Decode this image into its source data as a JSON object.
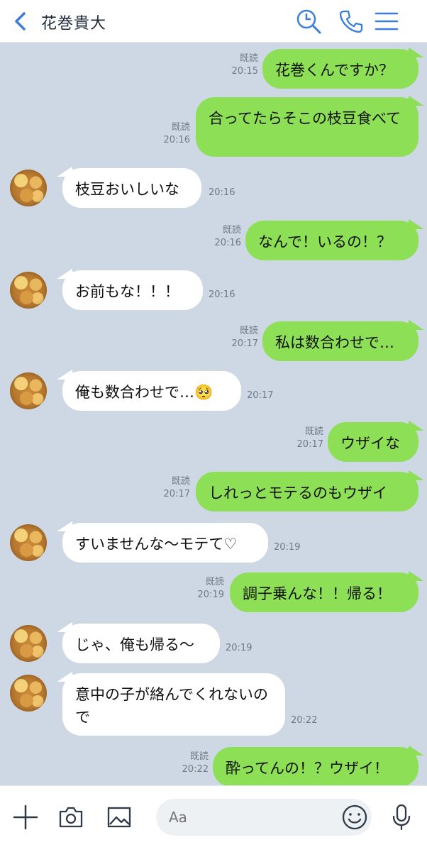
{
  "header": {
    "title": "花巻貴大"
  },
  "icons": {
    "back": "chevron-left-icon",
    "search": "search-icon",
    "call": "phone-icon",
    "menu": "hamburger-menu-icon"
  },
  "colors": {
    "outgoing": "#8de055",
    "incoming": "#ffffff",
    "chat_bg": "#ced7e4",
    "accent": "#3b7ddd"
  },
  "messages": [
    {
      "from": "me",
      "text": "花巻くんですか？",
      "read": "既読",
      "time": "20:15"
    },
    {
      "from": "me",
      "text": "合ってたらそこの枝豆食べて",
      "read": "既読",
      "time": "20:16"
    },
    {
      "from": "them",
      "text": "枝豆おいしいな",
      "time": "20:16"
    },
    {
      "from": "me",
      "text": "なんで！いるの！？",
      "read": "既読",
      "time": "20:16"
    },
    {
      "from": "them",
      "text": "お前もな！！！",
      "time": "20:16"
    },
    {
      "from": "me",
      "text": "私は数合わせで…",
      "read": "既読",
      "time": "20:17"
    },
    {
      "from": "them",
      "text": "俺も数合わせで…🥺",
      "time": "20:17"
    },
    {
      "from": "me",
      "text": "ウザイな",
      "read": "既読",
      "time": "20:17"
    },
    {
      "from": "me",
      "text": "しれっとモテるのもウザイ",
      "read": "既読",
      "time": "20:17"
    },
    {
      "from": "them",
      "text": "すいませんな〜モテて♡",
      "time": "20:19"
    },
    {
      "from": "me",
      "text": "調子乗んな！！帰る！",
      "read": "既読",
      "time": "20:19"
    },
    {
      "from": "them",
      "text": "じゃ、俺も帰る〜",
      "time": "20:19"
    },
    {
      "from": "them",
      "text": "意中の子が絡んでくれないので",
      "time": "20:22"
    },
    {
      "from": "me",
      "text": "酔ってんの！？ウザイ！",
      "read": "既読",
      "time": "20:22"
    }
  ],
  "input": {
    "placeholder": "Aa"
  }
}
